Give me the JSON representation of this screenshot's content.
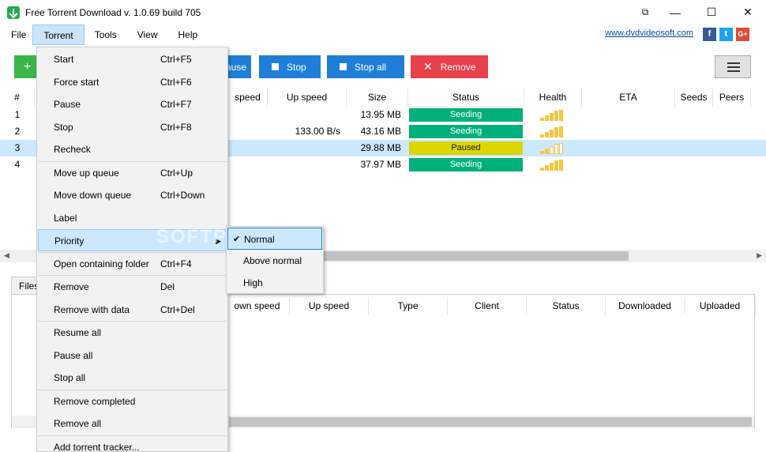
{
  "window": {
    "title": "Free Torrent Download v. 1.0.69 build 705",
    "controls": {
      "restore": "⧉",
      "minimize": "—",
      "maximize": "☐",
      "close": "✕"
    }
  },
  "menubar": {
    "items": [
      "File",
      "Torrent",
      "Tools",
      "View",
      "Help"
    ],
    "link": "www.dvdvideosoft.com",
    "social": {
      "facebook": "f",
      "twitter": "t",
      "googleplus": "G+"
    }
  },
  "toolbar": {
    "pause_label": "ause",
    "stop_label": "Stop",
    "stop_all_label": "Stop all",
    "remove_label": "Remove"
  },
  "upper_table": {
    "columns": [
      "#",
      "speed",
      "Up speed",
      "Size",
      "Status",
      "Health",
      "ETA",
      "Seeds",
      "Peers"
    ],
    "rows": [
      {
        "n": "1",
        "up": "",
        "size": "13.95 MB",
        "status": "Seeding",
        "health": [
          1,
          1,
          1,
          1,
          1
        ]
      },
      {
        "n": "2",
        "up": "133.00 B/s",
        "size": "43.16 MB",
        "status": "Seeding",
        "health": [
          1,
          1,
          1,
          1,
          1
        ]
      },
      {
        "n": "3",
        "up": "",
        "size": "29.88 MB",
        "status": "Paused",
        "health": [
          1,
          1,
          0,
          0,
          0
        ]
      },
      {
        "n": "4",
        "up": "",
        "size": "37.97 MB",
        "status": "Seeding",
        "health": [
          1,
          1,
          1,
          1,
          1
        ]
      }
    ]
  },
  "bottom_panel": {
    "tab": "Files",
    "columns": [
      "own speed",
      "Up speed",
      "Type",
      "Client",
      "Status",
      "Downloaded",
      "Uploaded"
    ]
  },
  "torrent_menu": {
    "groups": [
      [
        {
          "label": "Start",
          "shortcut": "Ctrl+F5"
        },
        {
          "label": "Force start",
          "shortcut": "Ctrl+F6"
        },
        {
          "label": "Pause",
          "shortcut": "Ctrl+F7"
        },
        {
          "label": "Stop",
          "shortcut": "Ctrl+F8"
        },
        {
          "label": "Recheck",
          "shortcut": ""
        }
      ],
      [
        {
          "label": "Move up queue",
          "shortcut": "Ctrl+Up"
        },
        {
          "label": "Move down queue",
          "shortcut": "Ctrl+Down"
        },
        {
          "label": "Label",
          "shortcut": ""
        },
        {
          "label": "Priority",
          "shortcut": ""
        }
      ],
      [
        {
          "label": "Open containing folder",
          "shortcut": "Ctrl+F4"
        }
      ],
      [
        {
          "label": "Remove",
          "shortcut": "Del"
        },
        {
          "label": "Remove with data",
          "shortcut": "Ctrl+Del"
        }
      ],
      [
        {
          "label": "Resume all",
          "shortcut": ""
        },
        {
          "label": "Pause all",
          "shortcut": ""
        },
        {
          "label": "Stop all",
          "shortcut": ""
        }
      ],
      [
        {
          "label": "Remove completed",
          "shortcut": ""
        },
        {
          "label": "Remove all",
          "shortcut": ""
        }
      ],
      [
        {
          "label": "Add torrent tracker...",
          "shortcut": ""
        }
      ]
    ]
  },
  "priority_submenu": {
    "items": [
      "Normal",
      "Above normal",
      "High"
    ],
    "checked": "Normal"
  },
  "watermark": "SOFTPEDIA",
  "colors": {
    "seeding": "#00b07a",
    "paused": "#dbd600",
    "stop_blue": "#1f7fd8",
    "remove_red": "#e8414b",
    "health": "#f7c744"
  }
}
